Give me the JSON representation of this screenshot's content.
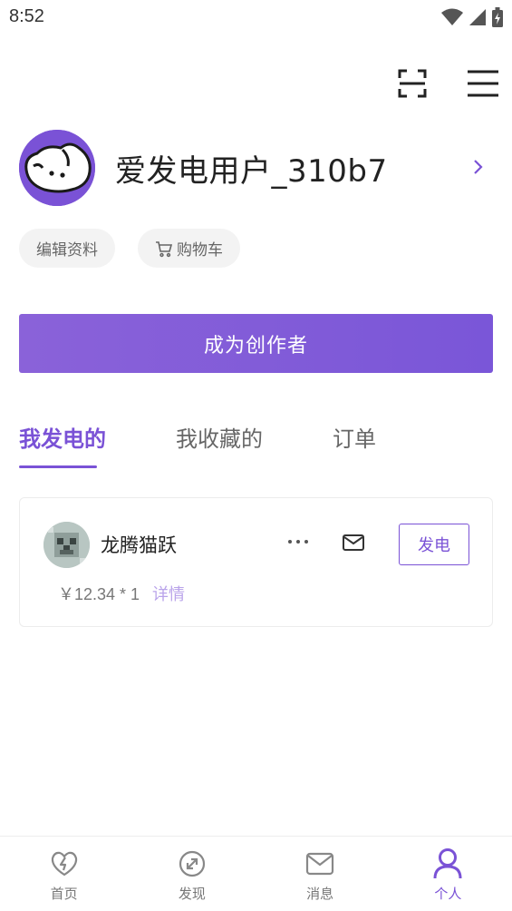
{
  "status_bar": {
    "time": "8:52"
  },
  "top_actions": {
    "scan_icon": "scan-icon",
    "menu_icon": "menu-icon"
  },
  "profile": {
    "username": "爱发电用户_310b7",
    "avatar_icon": "cartoon-face-avatar"
  },
  "chips": {
    "edit_profile": "编辑资料",
    "cart": "购物车"
  },
  "creator_button": {
    "label": "成为创作者"
  },
  "tabs": [
    {
      "label": "我发电的",
      "active": true
    },
    {
      "label": "我收藏的",
      "active": false
    },
    {
      "label": "订单",
      "active": false
    }
  ],
  "card": {
    "name": "龙腾猫跃",
    "price": "￥12.34 * 1",
    "detail": "详情",
    "action": "发电"
  },
  "bottom_nav": [
    {
      "label": "首页",
      "icon": "heart-bolt-icon",
      "active": false
    },
    {
      "label": "发现",
      "icon": "compass-icon",
      "active": false
    },
    {
      "label": "消息",
      "icon": "mail-icon",
      "active": false
    },
    {
      "label": "个人",
      "icon": "person-icon",
      "active": true
    }
  ],
  "colors": {
    "accent": "#7a52d6",
    "accent_light": "#b9a3ea"
  }
}
